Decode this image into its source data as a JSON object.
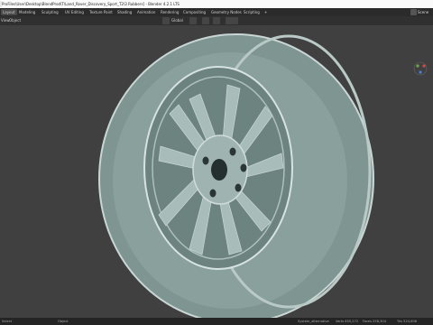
{
  "window": {
    "title": "ProFiles\\User\\Desktop\\BlendProd\\T\\Land_Rover_Discovery_Sport_T2\\3 Rubbers] - Blender 4.2.1 LTS"
  },
  "menubar": {
    "tabs": [
      "Layout",
      "Modeling",
      "Sculpting",
      "UV Editing",
      "Texture Paint",
      "Shading",
      "Animation",
      "Rendering",
      "Compositing",
      "Geometry Nodes",
      "Scripting",
      "+"
    ],
    "active": "Layout",
    "scene_label": "Scene"
  },
  "header": {
    "view": "View",
    "object": "Object",
    "transform": "Global"
  },
  "statusbar": {
    "left": "Select",
    "mid": "Object",
    "right_items": [
      "System_alternative",
      "Verts 655,272",
      "Faces 258,304",
      "Tris 524,606"
    ]
  },
  "colors": {
    "viewport_bg": "#404040",
    "wheel": "#9eb3b0"
  }
}
